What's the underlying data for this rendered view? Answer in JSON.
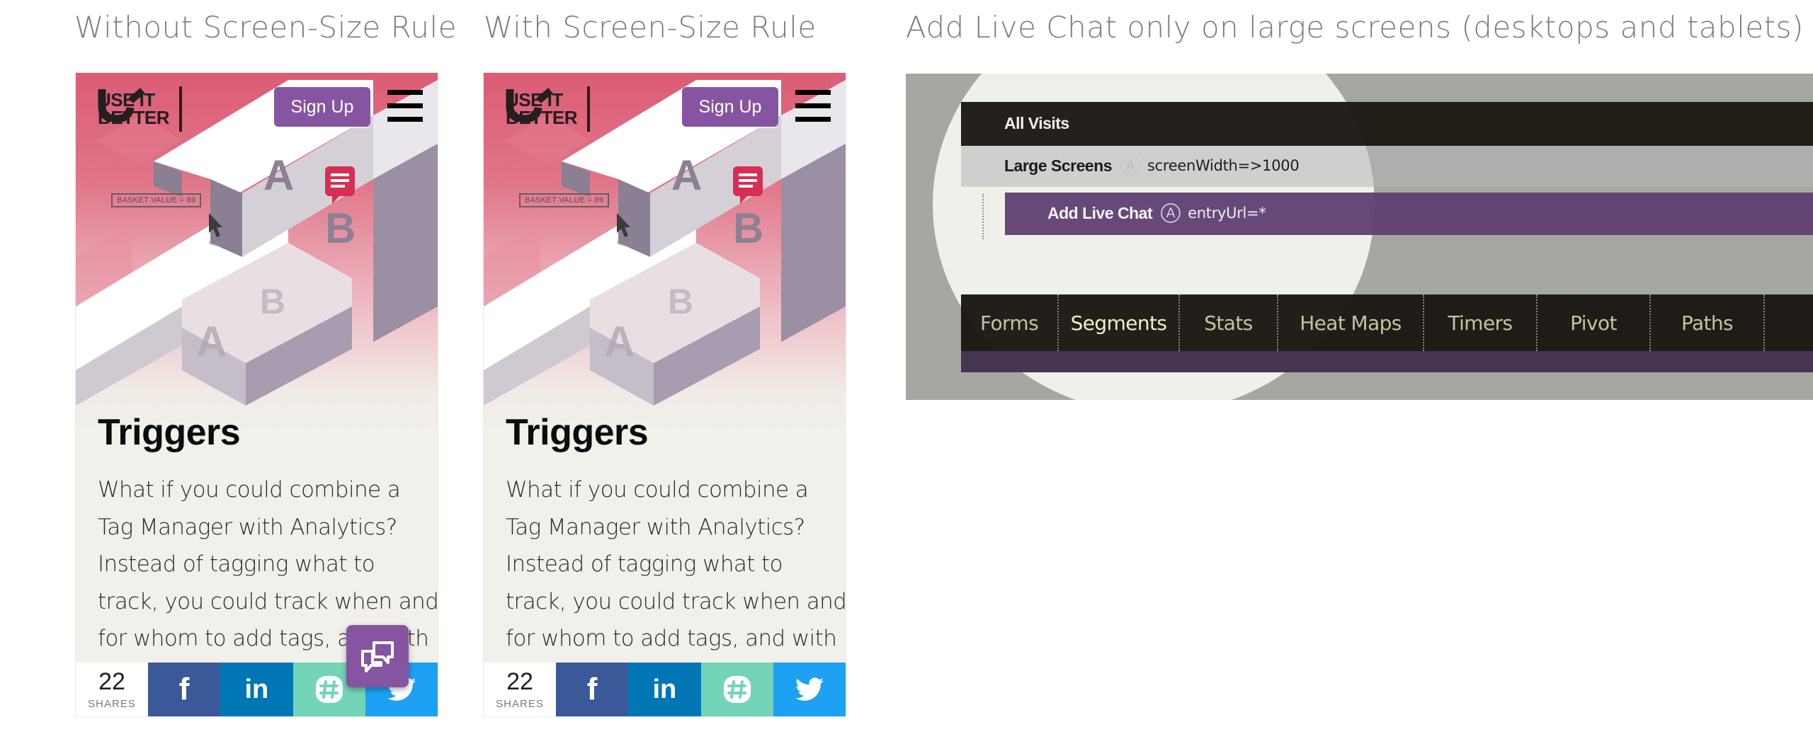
{
  "captions": {
    "without": "Without Screen-Size Rule",
    "with": "With Screen-Size Rule",
    "panel": "Add Live Chat only on large screens (desktops and tablets)"
  },
  "phones": [
    {
      "variant": "without",
      "logo": {
        "line1": "USE IT",
        "line2": "BETTER"
      },
      "signup_label": "Sign Up",
      "illustration": {
        "basket_label": "BASKET VALUE = 89",
        "letters": [
          "A",
          "B",
          "A",
          "B"
        ]
      },
      "title": "Triggers",
      "body_lines": [
        "What if you could combine a",
        "Tag Manager with Analytics?",
        "Instead of tagging what to",
        "track, you could track when and",
        "for whom to add tags, and with"
      ],
      "share": {
        "count": "22",
        "label": "SHARES",
        "buttons": [
          "facebook",
          "linkedin",
          "slack",
          "twitter"
        ]
      },
      "live_chat_visible": true
    },
    {
      "variant": "with",
      "logo": {
        "line1": "USE IT",
        "line2": "BETTER"
      },
      "signup_label": "Sign Up",
      "illustration": {
        "basket_label": "BASKET VALUE = 89",
        "letters": [
          "A",
          "B",
          "A",
          "B"
        ]
      },
      "title": "Triggers",
      "body_lines": [
        "What if you could combine a",
        "Tag Manager with Analytics?",
        "Instead of tagging what to",
        "track, you could track when and",
        "for whom to add tags, and with"
      ],
      "share": {
        "count": "22",
        "label": "SHARES",
        "buttons": [
          "facebook",
          "linkedin",
          "slack",
          "twitter"
        ]
      },
      "live_chat_visible": false
    }
  ],
  "panel": {
    "rows": [
      {
        "label": "All Visits"
      },
      {
        "label": "Large Screens",
        "badge": "A",
        "condition": "screenWidth=>1000"
      },
      {
        "label": "Add Live Chat",
        "badge": "A",
        "condition": "entryUrl=*"
      }
    ],
    "tabs": [
      {
        "label": "Forms",
        "active": false
      },
      {
        "label": "Segments",
        "active": true
      },
      {
        "label": "Stats",
        "active": false
      },
      {
        "label": "Heat Maps",
        "active": false
      },
      {
        "label": "Timers",
        "active": false
      },
      {
        "label": "Pivot",
        "active": false
      },
      {
        "label": "Paths",
        "active": false
      }
    ]
  },
  "colors": {
    "hero_pink": "#dc5c75",
    "brand_purple": "#8555a1",
    "facebook": "#3b5998",
    "linkedin": "#0077b5",
    "slack": "#74d4b8",
    "twitter": "#1da1f2",
    "panel_bg": "#a7a7a2",
    "panel_dark": "#1b1813",
    "rule_purple": "#5e3f73",
    "tab_text": "#c8c19e"
  }
}
